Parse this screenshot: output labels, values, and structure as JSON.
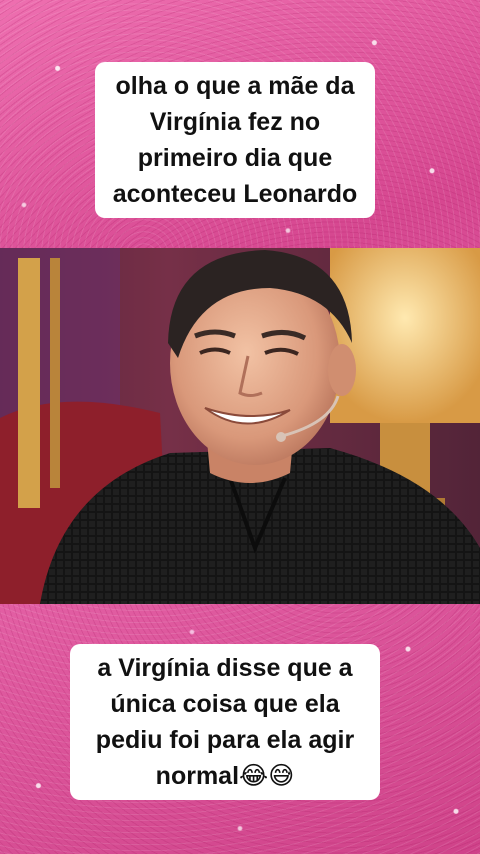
{
  "top_caption": {
    "lines": [
      "olha o que a mãe da",
      "Virgínia fez no",
      "primeiro dia que",
      "aconteceu Leonardo"
    ]
  },
  "video": {
    "subject": "man smiling with headset microphone in black knit sweater"
  },
  "bottom_caption": {
    "lines": [
      "a Virgínia disse que a",
      "única coisa que ela",
      "pediu foi para ela agir"
    ],
    "last_line_text": "normal",
    "emojis": [
      "😂",
      "😅"
    ]
  },
  "colors": {
    "background": "#e0539a",
    "caption_bg": "#ffffff",
    "caption_text": "#111111"
  }
}
